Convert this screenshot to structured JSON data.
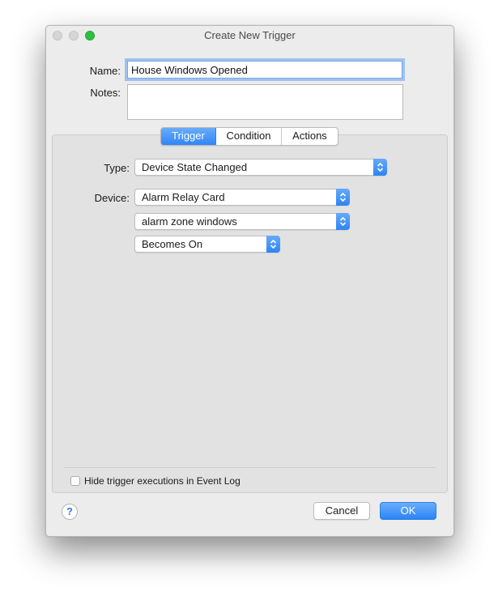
{
  "window": {
    "title": "Create New Trigger"
  },
  "form": {
    "name_label": "Name:",
    "name_value": "House Windows Opened",
    "notes_label": "Notes:",
    "notes_value": ""
  },
  "tabs": [
    {
      "label": "Trigger",
      "active": true
    },
    {
      "label": "Condition",
      "active": false
    },
    {
      "label": "Actions",
      "active": false
    }
  ],
  "trigger": {
    "type_label": "Type:",
    "type_value": "Device State Changed",
    "device_label": "Device:",
    "device_value": "Alarm Relay Card",
    "zone_value": "alarm zone windows",
    "state_value": "Becomes On"
  },
  "options": {
    "hide_log_label": "Hide trigger executions in Event Log",
    "hide_log_checked": false
  },
  "footer": {
    "help_symbol": "?",
    "cancel_label": "Cancel",
    "ok_label": "OK"
  },
  "colors": {
    "accent": "#2f86f5",
    "zoom_button": "#2ec13f"
  }
}
